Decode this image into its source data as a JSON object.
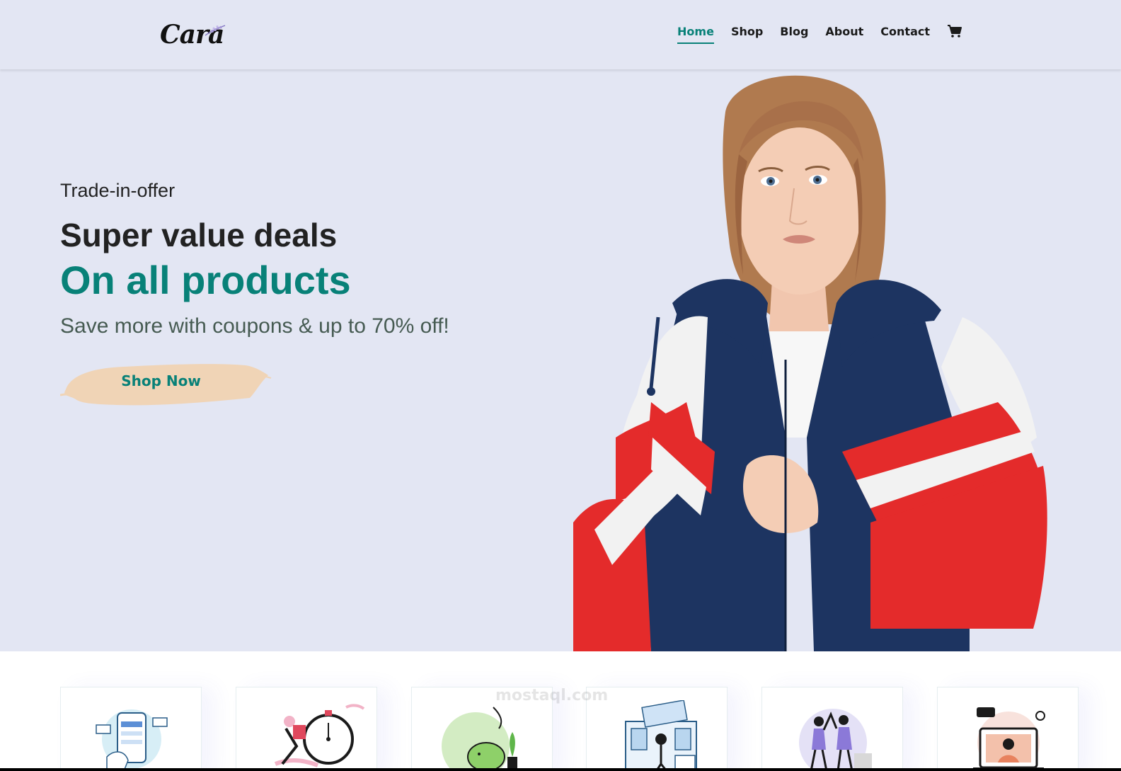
{
  "header": {
    "logo_text": "Cara",
    "nav": [
      {
        "label": "Home",
        "active": true
      },
      {
        "label": "Shop",
        "active": false
      },
      {
        "label": "Blog",
        "active": false
      },
      {
        "label": "About",
        "active": false
      },
      {
        "label": "Contact",
        "active": false
      }
    ],
    "cart_icon": "cart-icon"
  },
  "hero": {
    "eyebrow": "Trade-in-offer",
    "heading": "Super value deals",
    "highlight": "On all products",
    "subtitle": "Save more with coupons & up to 70% off!",
    "cta_label": "Shop Now"
  },
  "features": [
    {
      "icon": "mobile-payment-illustration"
    },
    {
      "icon": "fast-delivery-illustration"
    },
    {
      "icon": "savings-illustration"
    },
    {
      "icon": "promotions-illustration"
    },
    {
      "icon": "happy-sell-illustration"
    },
    {
      "icon": "support-illustration"
    }
  ],
  "watermark": "mostaql.com",
  "colors": {
    "accent": "#088178",
    "header_bg": "#e3e6f3",
    "cta_brush": "#f0d4b6"
  }
}
